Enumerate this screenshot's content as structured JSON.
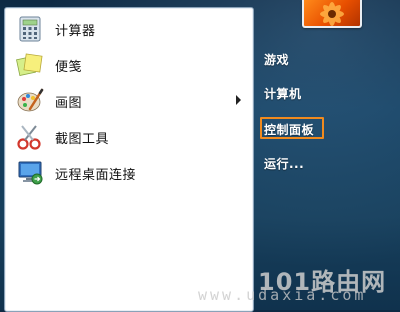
{
  "start_menu": {
    "programs": [
      {
        "label": "计算器",
        "icon": "calculator-icon"
      },
      {
        "label": "便笺",
        "icon": "sticky-notes-icon"
      },
      {
        "label": "画图",
        "icon": "paint-icon",
        "has_submenu": true
      },
      {
        "label": "截图工具",
        "icon": "snipping-tool-icon"
      },
      {
        "label": "远程桌面连接",
        "icon": "remote-desktop-icon"
      }
    ],
    "right_links": [
      {
        "label": "游戏"
      },
      {
        "label": "计算机"
      },
      {
        "label": "控制面板",
        "highlighted": true
      },
      {
        "label": "运行..."
      }
    ]
  },
  "watermark": {
    "brand": "101路由网",
    "url": "www.udaxia.com"
  },
  "colors": {
    "highlight_border": "#f08a1e",
    "taskbar_bg": "#123d5e",
    "avatar_orange": "#ff8a1a"
  }
}
